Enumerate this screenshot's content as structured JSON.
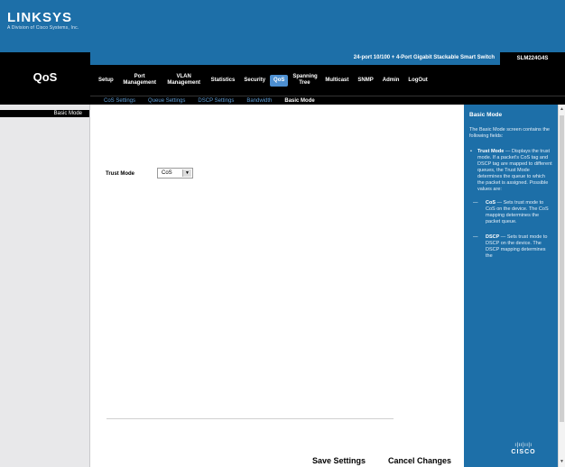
{
  "brand": {
    "logo": "LINKSYS",
    "tagline": "A Division of Cisco Systems, Inc."
  },
  "section_title": "QoS",
  "device": {
    "title": "24-port 10/100 + 4-Port Gigabit Stackable Smart Switch",
    "model": "SLM224G4S"
  },
  "main_nav": [
    {
      "label": "Setup"
    },
    {
      "label": "Port Management"
    },
    {
      "label": "VLAN Management"
    },
    {
      "label": "Statistics"
    },
    {
      "label": "Security"
    },
    {
      "label": "QoS"
    },
    {
      "label": "Spanning Tree"
    },
    {
      "label": "Multicast"
    },
    {
      "label": "SNMP"
    },
    {
      "label": "Admin"
    },
    {
      "label": "LogOut"
    }
  ],
  "sub_nav": [
    {
      "label": "CoS Settings"
    },
    {
      "label": "Queue Settings"
    },
    {
      "label": "DSCP Settings"
    },
    {
      "label": "Bandwidth"
    },
    {
      "label": "Basic Mode"
    }
  ],
  "side_menu": {
    "item": "Basic Mode"
  },
  "form": {
    "trust_mode_label": "Trust Mode",
    "trust_mode_value": "CoS"
  },
  "buttons": {
    "save": "Save Settings",
    "cancel": "Cancel Changes"
  },
  "help": {
    "title": "Basic Mode",
    "intro": "The Basic Mode screen contains the following fields:",
    "trust_title": "Trust Mode",
    "trust_text": "Displays the trust mode. If a packet's CoS tag and DSCP tag are mapped to different queues, the Trust Mode determines the queue to which the packet is assigned. Possible values are:",
    "cos_title": "CoS",
    "cos_text": "Sets trust mode to CoS on the device. The CoS mapping determines the packet queue.",
    "dscp_title": "DSCP",
    "dscp_text": "Sets trust mode to DSCP on the device. The DSCP mapping determines the"
  },
  "footer_logo": {
    "bars": "ı|ıı|ıı|ı",
    "word": "CISCO"
  },
  "colors": {
    "brand_blue": "#1d6fa8",
    "nav_black": "#000000",
    "active_tab": "#4d8fd1",
    "subnav_link": "#5f9fd9"
  }
}
